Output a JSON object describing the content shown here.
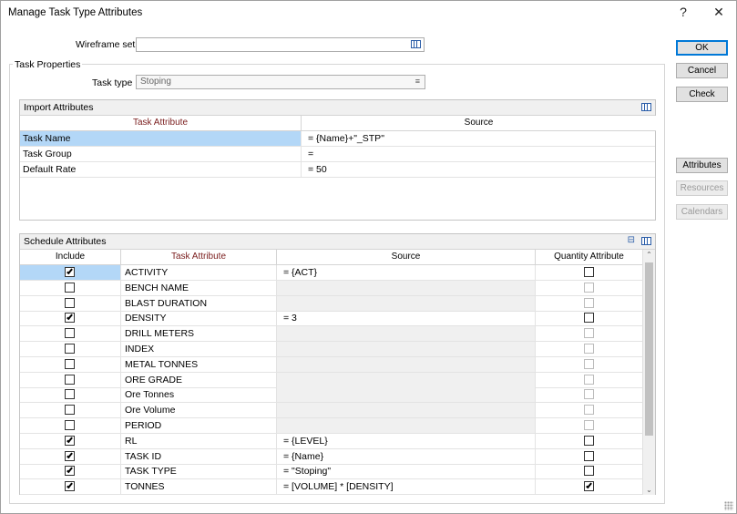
{
  "window": {
    "title": "Manage Task Type Attributes",
    "help_glyph": "?",
    "close_glyph": "✕"
  },
  "wireframe_set": {
    "label": "Wireframe set",
    "value": ""
  },
  "task_properties": {
    "group_title": "Task Properties",
    "task_type_label": "Task type",
    "task_type_value": "Stoping"
  },
  "buttons": {
    "ok": "OK",
    "cancel": "Cancel",
    "check": "Check",
    "attributes": "Attributes",
    "resources": "Resources",
    "calendars": "Calendars"
  },
  "import_attributes": {
    "title": "Import Attributes",
    "columns": [
      "Task Attribute",
      "Source"
    ],
    "rows": [
      {
        "attribute": "Task Name",
        "source": "=  {Name}+\"_STP\"",
        "selected": true
      },
      {
        "attribute": "Task Group",
        "source": "=",
        "selected": false
      },
      {
        "attribute": "Default Rate",
        "source": "=  50",
        "selected": false
      }
    ]
  },
  "schedule_attributes": {
    "title": "Schedule Attributes",
    "columns": [
      "Include",
      "Task Attribute",
      "Source",
      "Quantity Attribute"
    ],
    "rows": [
      {
        "include": true,
        "attribute": "ACTIVITY",
        "source": "=  {ACT}",
        "quantity": false,
        "enabled": true,
        "selected": true
      },
      {
        "include": false,
        "attribute": "BENCH NAME",
        "source": "",
        "quantity": false,
        "enabled": false,
        "selected": false
      },
      {
        "include": false,
        "attribute": "BLAST DURATION",
        "source": "",
        "quantity": false,
        "enabled": false,
        "selected": false
      },
      {
        "include": true,
        "attribute": "DENSITY",
        "source": "=  3",
        "quantity": false,
        "enabled": true,
        "selected": false
      },
      {
        "include": false,
        "attribute": "DRILL METERS",
        "source": "",
        "quantity": false,
        "enabled": false,
        "selected": false
      },
      {
        "include": false,
        "attribute": "INDEX",
        "source": "",
        "quantity": false,
        "enabled": false,
        "selected": false
      },
      {
        "include": false,
        "attribute": "METAL TONNES",
        "source": "",
        "quantity": false,
        "enabled": false,
        "selected": false
      },
      {
        "include": false,
        "attribute": "ORE GRADE",
        "source": "",
        "quantity": false,
        "enabled": false,
        "selected": false
      },
      {
        "include": false,
        "attribute": "Ore Tonnes",
        "source": "",
        "quantity": false,
        "enabled": false,
        "selected": false
      },
      {
        "include": false,
        "attribute": "Ore Volume",
        "source": "",
        "quantity": false,
        "enabled": false,
        "selected": false
      },
      {
        "include": false,
        "attribute": "PERIOD",
        "source": "",
        "quantity": false,
        "enabled": false,
        "selected": false
      },
      {
        "include": true,
        "attribute": "RL",
        "source": "=  {LEVEL}",
        "quantity": false,
        "enabled": true,
        "selected": false
      },
      {
        "include": true,
        "attribute": "TASK ID",
        "source": "=  {Name}",
        "quantity": false,
        "enabled": true,
        "selected": false
      },
      {
        "include": true,
        "attribute": "TASK TYPE",
        "source": "=  \"Stoping\"",
        "quantity": false,
        "enabled": true,
        "selected": false
      },
      {
        "include": true,
        "attribute": "TONNES",
        "source": "=   [VOLUME] * [DENSITY]",
        "quantity": true,
        "enabled": true,
        "selected": false
      }
    ]
  },
  "colors": {
    "selection": "#b3d7f7",
    "attribute_header": "#7a1d1d",
    "default_button_border": "#0078d7"
  }
}
